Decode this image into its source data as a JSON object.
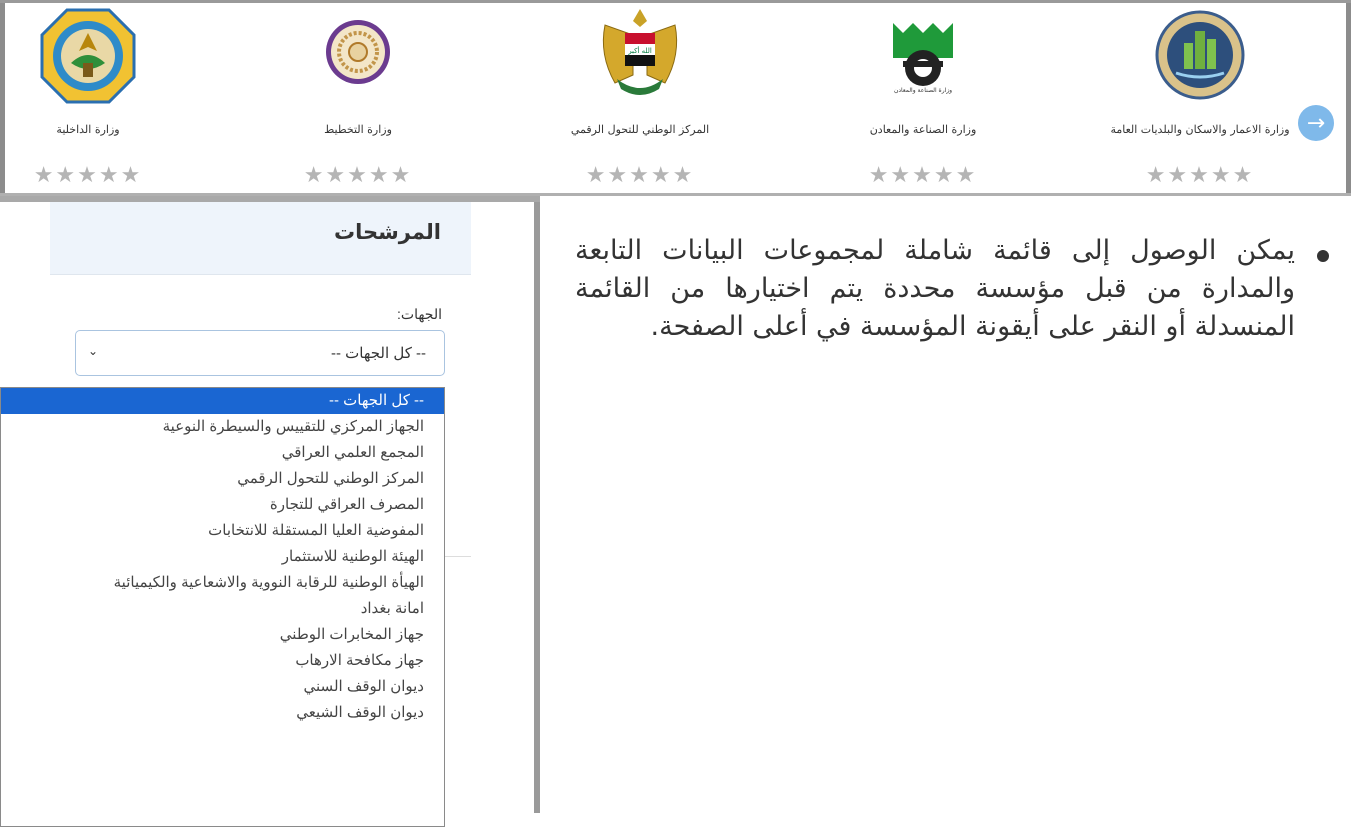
{
  "carousel": {
    "cards": [
      {
        "name": "وزارة الاعمار والاسكان والبلديات العامة",
        "logo_icon": "housing-ministry-logo-icon",
        "rating": "★★★★★"
      },
      {
        "name": "وزارة الصناعة والمعادن",
        "logo_icon": "industry-ministry-logo-icon",
        "rating": "★★★★★"
      },
      {
        "name": "المركز الوطني للتحول الرقمي",
        "logo_icon": "iraq-eagle-emblem-icon",
        "rating": "★★★★★"
      },
      {
        "name": "وزارة التخطيط",
        "logo_icon": "planning-ministry-logo-icon",
        "rating": "★★★★★"
      },
      {
        "name": "وزارة الداخلية",
        "logo_icon": "interior-ministry-logo-icon",
        "rating": "★★★★★"
      }
    ],
    "next_arrow": "→"
  },
  "filters": {
    "title": "المرشحات",
    "entity_label": "الجهات:",
    "selected_value": "-- كل الجهات --",
    "chevron": "⌄",
    "options": [
      "-- كل الجهات --",
      "الجهاز المركزي للتقييس والسيطرة النوعية",
      "المجمع العلمي العراقي",
      "المركز الوطني للتحول الرقمي",
      "المصرف العراقي للتجارة",
      "المفوضية العليا المستقلة للانتخابات",
      "الهيئة الوطنية للاستثمار",
      "الهيأة الوطنية للرقابة النووية والاشعاعية والكيميائية",
      "امانة بغداد",
      "جهاز المخابرات الوطني",
      "جهاز مكافحة الارهاب",
      "ديوان الوقف السني",
      "ديوان الوقف الشيعي"
    ]
  },
  "explanation": {
    "text": "يمكن الوصول إلى قائمة شاملة لمجموعات البيانات التابعة والمدارة من قبل مؤسسة محددة يتم اختيارها من القائمة المنسدلة أو النقر على أيقونة المؤسسة في أعلى الصفحة."
  },
  "colors": {
    "accent": "#1a66d2",
    "arrow": "#7fb9ea",
    "header_bg": "#eef4fb",
    "stars": "#b5b5b5"
  }
}
